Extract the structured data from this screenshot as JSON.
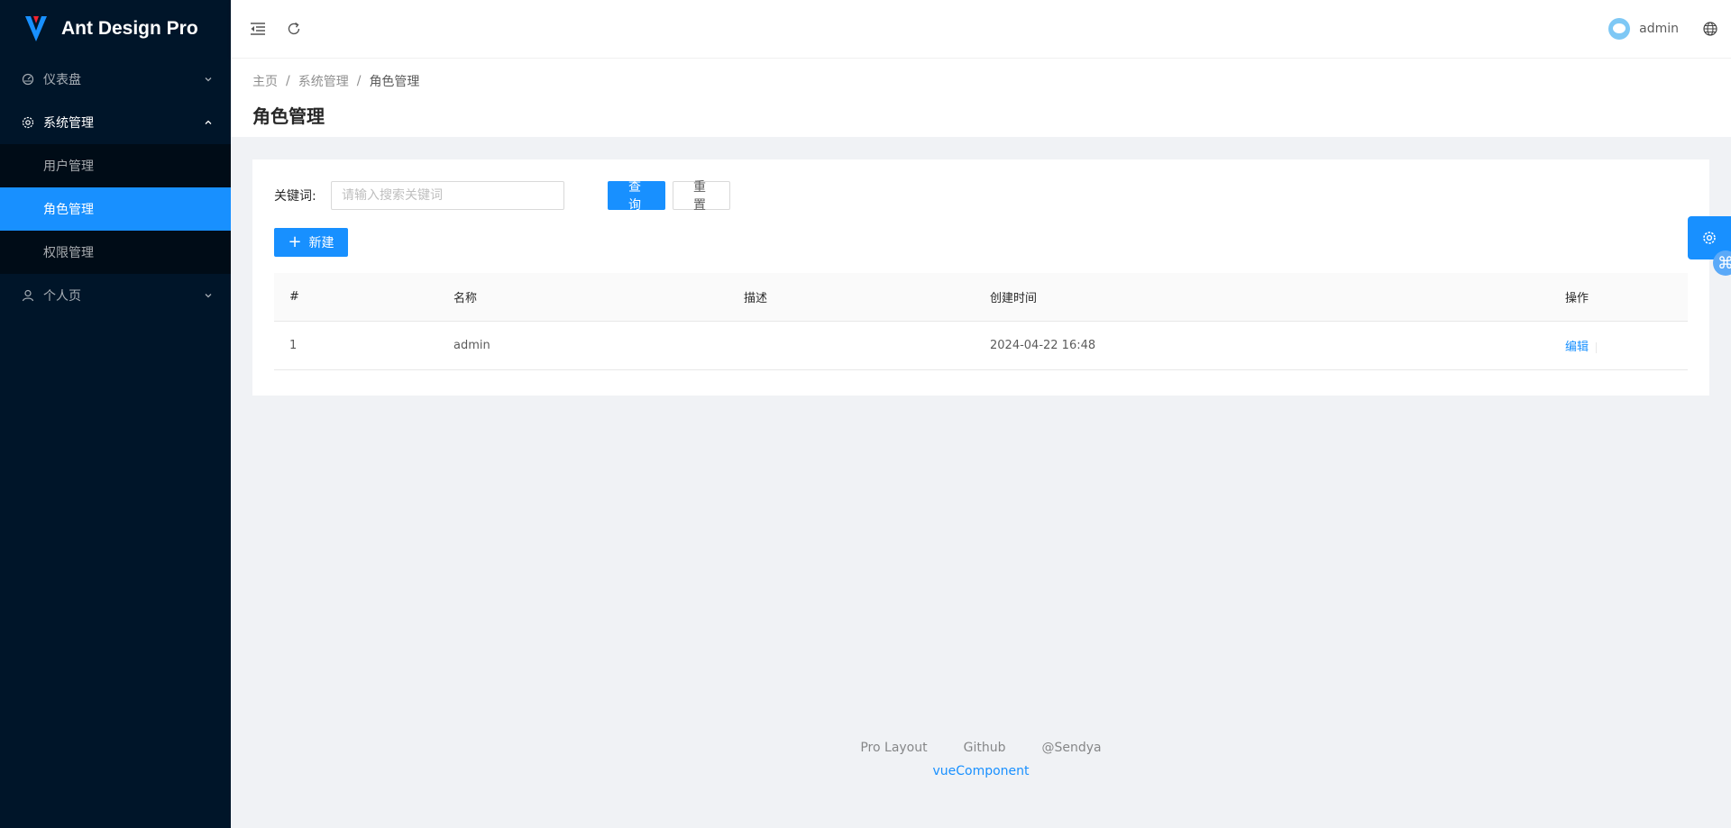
{
  "app": {
    "title": "Ant Design Pro"
  },
  "sidebar": {
    "items": [
      {
        "label": "仪表盘",
        "icon": "dashboard-icon"
      },
      {
        "label": "系统管理",
        "icon": "setting-icon"
      },
      {
        "label": "个人页",
        "icon": "user-icon"
      }
    ],
    "system_children": [
      {
        "label": "用户管理"
      },
      {
        "label": "角色管理"
      },
      {
        "label": "权限管理"
      }
    ]
  },
  "header": {
    "user_name": "admin"
  },
  "breadcrumb": [
    "主页",
    "系统管理",
    "角色管理"
  ],
  "page": {
    "title": "角色管理"
  },
  "search": {
    "label": "关键词:",
    "placeholder": "请输入搜索关键词",
    "value": "",
    "query_label": "查询",
    "reset_label": "重置"
  },
  "toolbar": {
    "new_label": "新建"
  },
  "table": {
    "columns": [
      "#",
      "名称",
      "描述",
      "创建时间",
      "操作"
    ],
    "rows": [
      {
        "index": "1",
        "name": "admin",
        "description": "",
        "created": "2024-04-22 16:48",
        "action": "编辑"
      }
    ]
  },
  "footer": {
    "links": [
      "Pro Layout",
      "Github",
      "@Sendya"
    ],
    "copyright": "vueComponent"
  },
  "colors": {
    "primary": "#1890ff",
    "sidebar_bg": "#001529"
  }
}
